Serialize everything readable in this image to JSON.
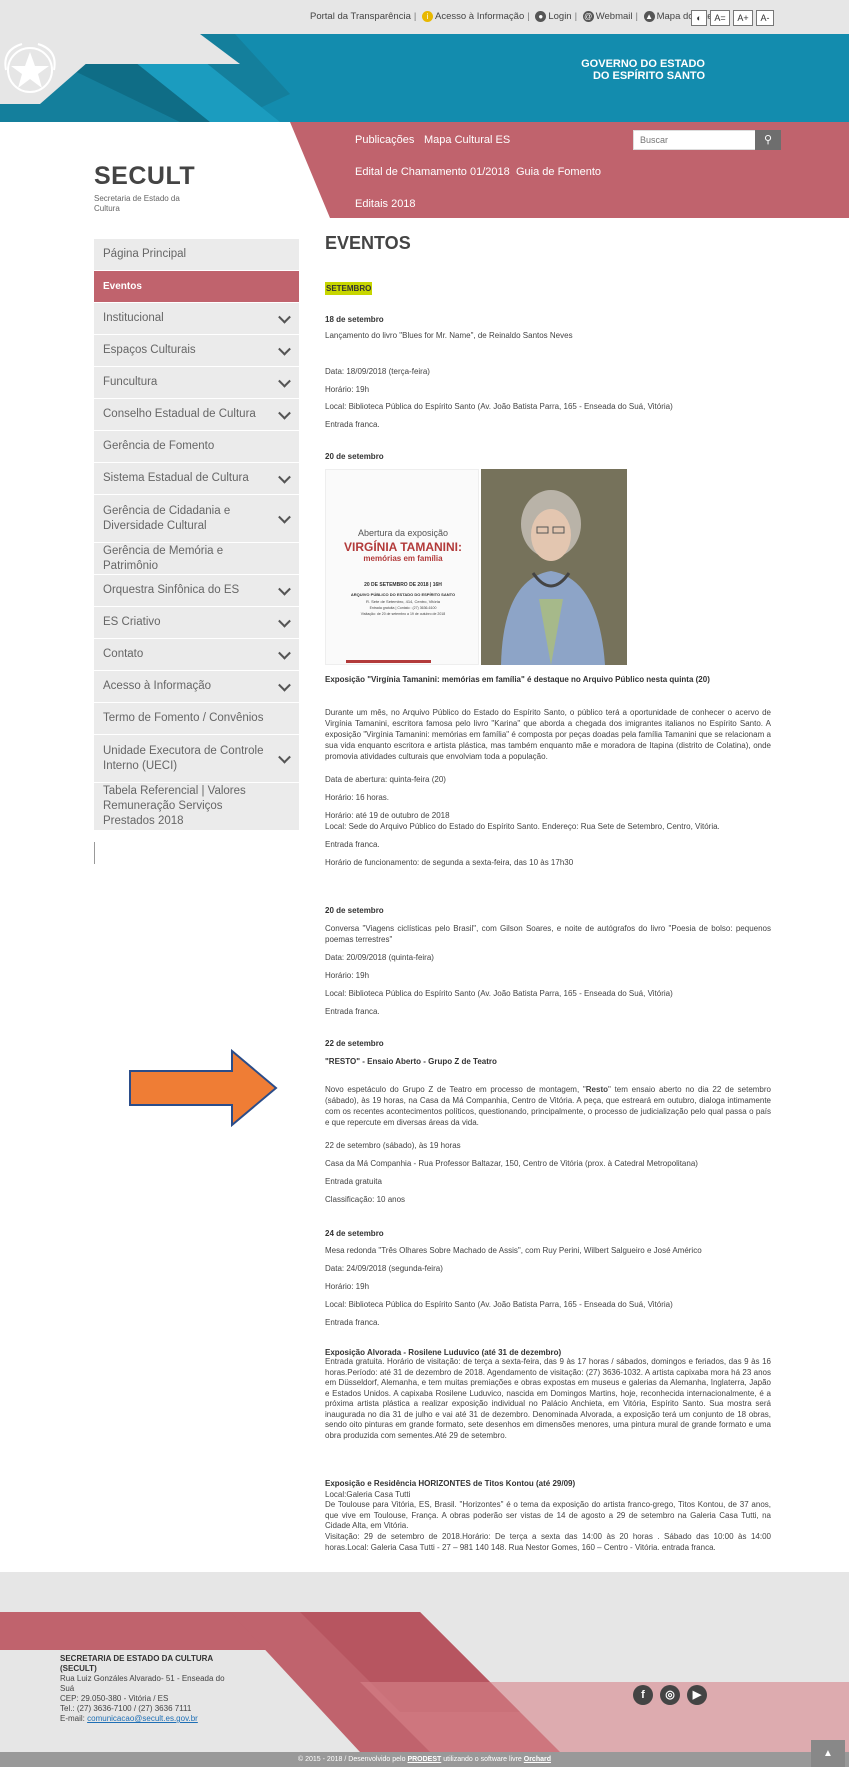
{
  "topbar": {
    "transparencia": "Portal da Transparência",
    "acesso": "Acesso à Informação",
    "login": "Login",
    "webmail": "Webmail",
    "mapa": "Mapa do Site",
    "a_normal": "A=",
    "a_plus": "A+",
    "a_minus": "A-"
  },
  "header": {
    "gov_line1": "GOVERNO DO ESTADO",
    "gov_line2": "DO ESPÍRITO SANTO",
    "site_title": "SECULT",
    "site_subtitle": "Secretaria de Estado da Cultura"
  },
  "menu": {
    "items": [
      "Publicações",
      "Mapa Cultural ES",
      "Edital de Chamamento 01/2018",
      "Guia de Fomento",
      "Editais 2018"
    ],
    "search_placeholder": "Buscar"
  },
  "sidebar": {
    "items": [
      {
        "label": "Página Principal",
        "expand": false
      },
      {
        "label": "Eventos",
        "expand": false,
        "active": true
      },
      {
        "label": "Institucional",
        "expand": true
      },
      {
        "label": "Espaços Culturais",
        "expand": true
      },
      {
        "label": "Funcultura",
        "expand": true
      },
      {
        "label": "Conselho Estadual de Cultura",
        "expand": true
      },
      {
        "label": "Gerência de Fomento",
        "expand": false
      },
      {
        "label": "Sistema Estadual de Cultura",
        "expand": true
      },
      {
        "label": "Gerência de Cidadania e Diversidade Cultural",
        "expand": true,
        "tall": true
      },
      {
        "label": "Gerência de Memória e Patrimônio",
        "expand": false
      },
      {
        "label": "Orquestra Sinfônica do ES",
        "expand": true
      },
      {
        "label": "ES Criativo",
        "expand": true
      },
      {
        "label": "Contato",
        "expand": true
      },
      {
        "label": "Acesso à Informação",
        "expand": true
      },
      {
        "label": "Termo de Fomento / Convênios",
        "expand": false
      },
      {
        "label": "Unidade Executora de Controle Interno (UECI)",
        "expand": true,
        "tall": true
      },
      {
        "label": "Tabela Referencial | Valores Remuneração Serviços Prestados 2018",
        "expand": false,
        "tall": true
      }
    ]
  },
  "content": {
    "page_title": "EVENTOS",
    "month": "SETEMBRO",
    "e1_date": "18 de setembro",
    "e1_desc": "Lançamento do livro \"Blues for Mr. Name\", de Reinaldo Santos Neves",
    "e1_data": "Data: 18/09/2018 (terça-feira)",
    "e1_hora": "Horário: 19h",
    "e1_local": "Local: Biblioteca Pública do Espírito Santo (Av. João Batista Parra, 165 - Enseada do Suá, Vitória)",
    "e1_entrada": "Entrada franca.",
    "e2_date": "20 de setembro",
    "poster_l1": "Abertura da exposição",
    "poster_l2": "VIRGÍNIA TAMANINI:",
    "poster_l3": "memórias em família",
    "poster_l4": "20 DE SETEMBRO DE 2018 | 16H",
    "poster_l5": "ARQUIVO PÚBLICO DO ESTADO DO ESPÍRITO SANTO",
    "poster_l6": "R. Sete de Setembro, 414, Centro, Vitória",
    "poster_l7": "Entrada gratuita | Contato : (27) 3636-6100",
    "poster_l8": "Visitação: de 20 de setembro a 19 de outubro de 2018",
    "e2_title": "Exposição \"Virgínia Tamanini: memórias em família\" é destaque no Arquivo Público nesta quinta (20)",
    "e2_body": "Durante um mês, no Arquivo Público do Estado do Espírito Santo, o público terá a oportunidade de conhecer o acervo de Virgínia Tamanini, escritora famosa pelo livro \"Karina\" que aborda a chegada dos imigrantes italianos no Espírito Santo. A exposição \"Virgínia Tamanini: memórias em família\" é composta por peças doadas pela família Tamanini que se relacionam a sua vida enquanto escritora e artista plástica, mas também enquanto mãe e moradora de Itapina (distrito de Colatina), onde promovia atividades culturais que envolviam toda a população.",
    "e2_abertura": "Data de abertura: quinta-feira (20)",
    "e2_hora": "Horário: 16 horas.",
    "e2_ate": "Horário: até 19 de outubro de 2018",
    "e2_local": "Local: Sede do Arquivo Público do Estado do Espírito Santo. Endereço: Rua Sete de Setembro, Centro, Vitória.",
    "e2_entrada": "Entrada franca.",
    "e2_func": "Horário de funcionamento: de segunda a sexta-feira, das 10 às 17h30",
    "e3_date": "20 de setembro",
    "e3_desc": "Conversa \"Viagens ciclísticas pelo Brasil\", com Gilson Soares, e noite de autógrafos do livro \"Poesia de bolso: pequenos poemas terrestres\"",
    "e3_data": "Data: 20/09/2018 (quinta-feira)",
    "e3_hora": "Horário: 19h",
    "e3_local": "Local: Biblioteca Pública do Espírito Santo (Av. João Batista Parra, 165 - Enseada do Suá, Vitória)",
    "e3_entrada": "Entrada franca.",
    "e4_date": "22 de setembro",
    "e4_title": "\"RESTO\" - Ensaio Aberto - Grupo Z de Teatro",
    "e4_body_a": "Novo espetáculo do Grupo Z de Teatro em processo de montagem, \"",
    "e4_body_b": "Resto",
    "e4_body_c": "\" tem ensaio aberto no dia 22 de setembro (sábado), às 19 horas, na Casa da Má Companhia, Centro de Vitória. A peça, que estreará em outubro, dialoga intimamente com os recentes acontecimentos políticos, questionando, principalmente, o processo de judicialização pelo qual passa o país e que repercute em diversas áreas da vida.",
    "e4_when": "22 de setembro (sábado), às 19 horas",
    "e4_where": "Casa da Má Companhia - Rua Professor Baltazar, 150, Centro de Vitória (prox. à Catedral Metropolitana)",
    "e4_entrada": "Entrada gratuita",
    "e4_class": "Classificação: 10 anos",
    "e5_date": "24 de setembro",
    "e5_desc": "Mesa redonda \"Três Olhares Sobre Machado de Assis\", com Ruy Perini, Wilbert Salgueiro e José Américo",
    "e5_data": "Data: 24/09/2018 (segunda-feira)",
    "e5_hora": "Horário: 19h",
    "e5_local": "Local: Biblioteca Pública do Espírito Santo (Av. João Batista Parra, 165 - Enseada do Suá, Vitória)",
    "e5_entrada": "Entrada franca.",
    "e6_title": "Exposição Alvorada - Rosilene Luduvico (até 31 de dezembro)",
    "e6_body": "Entrada gratuita. Horário de visitação: de terça a sexta-feira, das 9 às 17 horas / sábados, domingos e feriados, das 9 às 16 horas.Período: até 31 de dezembro de 2018. Agendamento de visitação: (27) 3636-1032. A artista capixaba mora há 23 anos em Düsseldorf, Alemanha, e tem muitas premiações e obras expostas em museus e galerias da Alemanha, Inglaterra, Japão e Estados Unidos. A capixaba Rosilene Luduvico, nascida em Domingos Martins, hoje, reconhecida internacionalmente, é a próxima artista plástica a realizar exposição individual no Palácio Anchieta, em Vitória, Espírito Santo. Sua mostra será inaugurada no dia 31 de julho e vai até 31 de dezembro. Denominada Alvorada, a exposição terá um conjunto de 18 obras, sendo oito pinturas em grande formato, sete desenhos em dimensões menores, uma pintura mural de grande formato e uma obra produzida com sementes.Até 29  de setembro.",
    "e7_title": "Exposição e Residência HORIZONTES de Titos Kontou (até 29/09)",
    "e7_local": "Local:Galeria Casa Tutti",
    "e7_body": "De Toulouse para Vitória, ES, Brasil. \"Horizontes\" é o tema da exposição do artista franco-grego, Titos Kontou, de 37 anos, que vive em Toulouse, França. A obras poderão ser vistas de 14 de agosto a 29 de setembro na Galeria Casa Tutti, na Cidade Alta, em Vitória.",
    "e7_visit": "Visitação: 29 de setembro de 2018.Horário: De terça a sexta das 14:00 às 20 horas . Sábado das 10:00 às 14:00 horas.Local: Galeria Casa Tutti - 27 – 981 140 148. Rua Nestor Gomes, 160 – Centro - Vitória. entrada franca."
  },
  "footer": {
    "org": "SECRETARIA DE ESTADO DA CULTURA (SECULT)",
    "addr": "Rua Luiz Gonzáles Alvarado- 51 - Enseada do Suá",
    "cep": "CEP: 29.050-380 - Vitória / ES",
    "tel": "Tel.: (27) 3636-7100 / (27) 3636 7111",
    "email_label": "E-mail: ",
    "email": "comunicacao@secult.es.gov.br",
    "copy_a": "© 2015 - 2018 / Desenvolvido pelo ",
    "copy_b": "PRODEST",
    "copy_c": " utilizando o software livre ",
    "copy_d": "Orchard"
  },
  "colors": {
    "teal": "#138cae",
    "pink": "#c0636d",
    "highlight": "#c7d600",
    "arrow": "#ef7d35"
  }
}
